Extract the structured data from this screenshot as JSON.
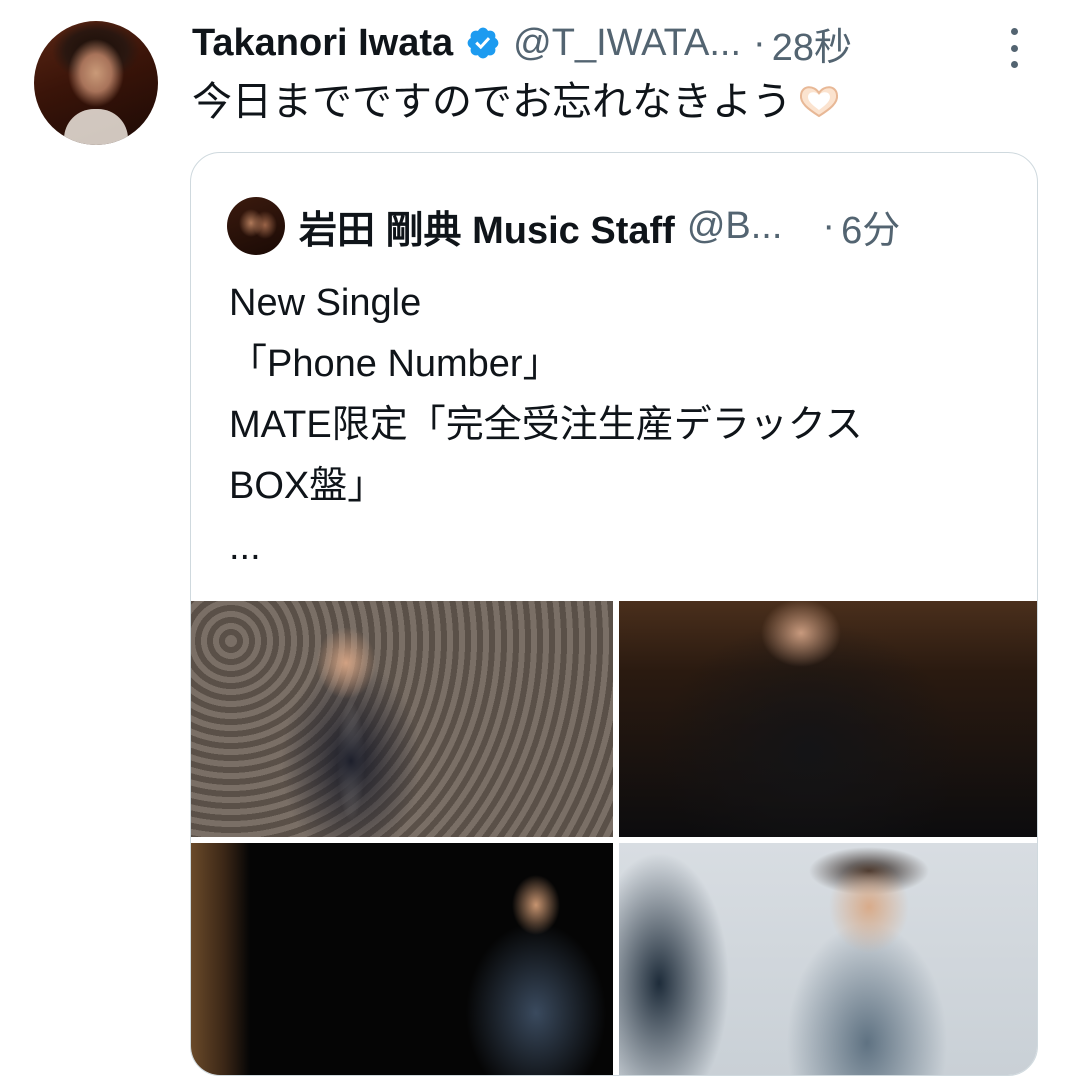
{
  "tweet": {
    "author_name": "Takanori Iwata",
    "author_handle": "@T_IWATA...",
    "separator": "·",
    "time": "28秒",
    "text": "今日までですのでお忘れなきよう",
    "emoji": "heart-hands-icon"
  },
  "quoted": {
    "author_name": "岩田 剛典 Music Staff",
    "author_handle": "@B...",
    "separator": "·",
    "time": "6分",
    "lines": [
      "New Single",
      "「Phone Number」",
      " MATE限定「完全受注生産デラックス",
      "BOX盤」",
      "..."
    ]
  },
  "colors": {
    "verified": "#1d9bf0",
    "secondary_text": "#536471",
    "border": "#cfd9de"
  }
}
